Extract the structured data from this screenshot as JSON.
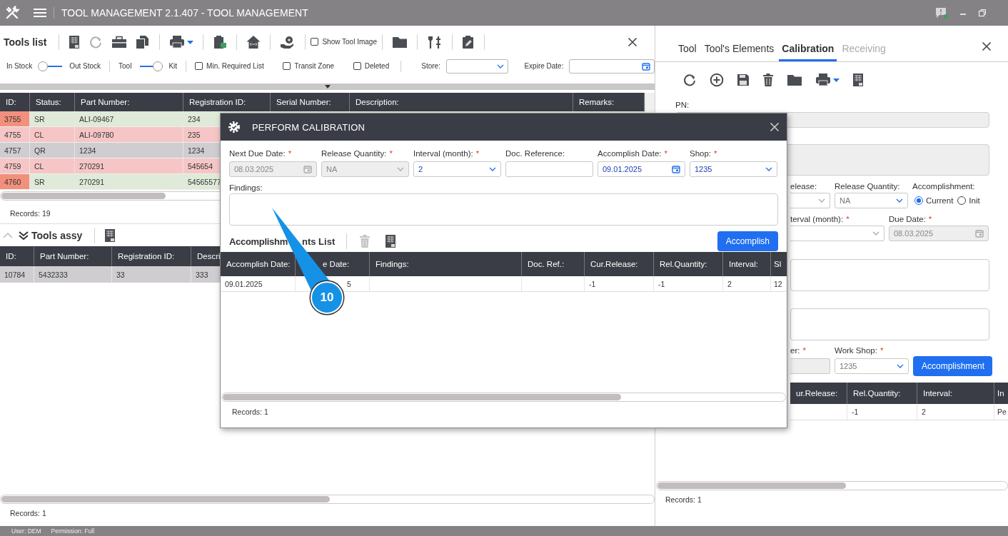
{
  "title_bar": {
    "title": "TOOL MANAGEMENT 2.1.407 - TOOL MANAGEMENT"
  },
  "tools_list": {
    "title": "Tools list",
    "show_tool_image": {
      "label": "Show Tool Image",
      "checked": false
    },
    "toggles": [
      {
        "left": "In Stock",
        "right": "Out Stock",
        "on": false
      },
      {
        "left": "Tool",
        "right": "Kit",
        "on": true
      }
    ],
    "checkboxes": [
      {
        "label": "Min. Required List",
        "checked": false
      },
      {
        "label": "Transit Zone",
        "checked": false
      },
      {
        "label": "Deleted",
        "checked": false
      }
    ],
    "store": {
      "label": "Store:"
    },
    "expire_date": {
      "label": "Expire Date:"
    },
    "table": {
      "columns": [
        "ID:",
        "Status:",
        "Part Number:",
        "Registration ID:",
        "Serial Number:",
        "Description:",
        "Remarks:"
      ],
      "rows": [
        {
          "id": "3755",
          "status": "SR",
          "part_number": "ALI-09467",
          "registration_id": "234",
          "color": "#dfead8",
          "flagged": true
        },
        {
          "id": "4755",
          "status": "CL",
          "part_number": "ALI-09780",
          "registration_id": "235",
          "color": "#f6c6c6",
          "flagged": false
        },
        {
          "id": "4757",
          "status": "QR",
          "part_number": "1234",
          "registration_id": "1234",
          "color": "#cfcdd0",
          "flagged": false
        },
        {
          "id": "4759",
          "status": "CL",
          "part_number": "270291",
          "registration_id": "545654",
          "color": "#f6c6c6",
          "flagged": false
        },
        {
          "id": "4760",
          "status": "SR",
          "part_number": "270291",
          "registration_id": "54565577",
          "color": "#dfead8",
          "flagged": true
        }
      ]
    },
    "records": "Records: 19"
  },
  "tools_assy": {
    "title": "Tools assy",
    "table": {
      "columns": [
        "ID:",
        "Part Number:",
        "Registration ID:",
        "Descri"
      ],
      "rows": [
        [
          "10784",
          "5432333",
          "33",
          "333"
        ]
      ]
    },
    "records": "Records: 1"
  },
  "detail_panel": {
    "tabs": [
      {
        "label": "Tool",
        "selected": false,
        "disabled": false
      },
      {
        "label": "Tool's Elements",
        "selected": false,
        "disabled": false
      },
      {
        "label": "Calibration",
        "selected": true,
        "disabled": false
      },
      {
        "label": "Receiving",
        "selected": false,
        "disabled": true
      }
    ],
    "pn": {
      "label": "PN:"
    },
    "release": {
      "label": "elease:"
    },
    "release_quantity": {
      "label": "Release Quantity:",
      "value": "NA"
    },
    "accomplishment": {
      "label": "Accomplishment:",
      "options": [
        {
          "label": "Current",
          "selected": true
        },
        {
          "label": "Init",
          "selected": false
        }
      ]
    },
    "interval": {
      "label": "terval (month):",
      "mark": "*"
    },
    "due_date": {
      "label": "Due Date:",
      "mark": "*",
      "value": "08.03.2025"
    },
    "number": {
      "label": "er:",
      "mark": "*"
    },
    "work_shop": {
      "label": "Work Shop:",
      "mark": "*",
      "value": "1235"
    },
    "accomplish_button": "Accomplishment",
    "table": {
      "columns": [
        "ur.Release:",
        "Rel.Quantity:",
        "Interval:",
        "In"
      ],
      "rows": [
        {
          "rel_quantity": "-1",
          "interval": "2",
          "column_4": "Pe"
        }
      ]
    },
    "records": "Records: 1"
  },
  "dialog": {
    "title": "PERFORM CALIBRATION",
    "fields": [
      {
        "label": "Next Due Date:",
        "mark": "*",
        "kind": "date",
        "value": "08.03.2025",
        "disabled": true
      },
      {
        "label": "Release Quantity:",
        "mark": "*",
        "kind": "select",
        "value": "NA",
        "disabled": true
      },
      {
        "label": "Interval (month):",
        "mark": "*",
        "kind": "select",
        "value": "2",
        "disabled": false
      },
      {
        "label": "Doc. Reference:",
        "kind": "text",
        "disabled": false
      },
      {
        "label": "Accomplish Date:",
        "mark": "*",
        "kind": "date",
        "value": "09.01.2025",
        "disabled": false
      },
      {
        "label": "Shop:",
        "mark": "*",
        "kind": "select",
        "value": "1235",
        "disabled": false
      }
    ],
    "findings": {
      "label": "Findings:"
    },
    "list_title": [
      "Accomplishm",
      "nts List"
    ],
    "accomplish_button": "Accomplish",
    "table": {
      "columns": [
        "Accomplish Date:",
        "e Date:",
        "Findings:",
        "Doc. Ref.:",
        "Cur.Release:",
        "Rel.Quantity:",
        "Interval:",
        "Sl"
      ],
      "rows": [
        {
          "cells": [
            "09.01.2025",
            "5",
            null,
            null,
            "-1",
            "-1",
            "2",
            "12"
          ]
        }
      ]
    },
    "records": "Records: 1"
  },
  "callout": {
    "label": "10"
  },
  "status_bar": {
    "user": "User: DEM",
    "permission": "Permission: Full"
  }
}
